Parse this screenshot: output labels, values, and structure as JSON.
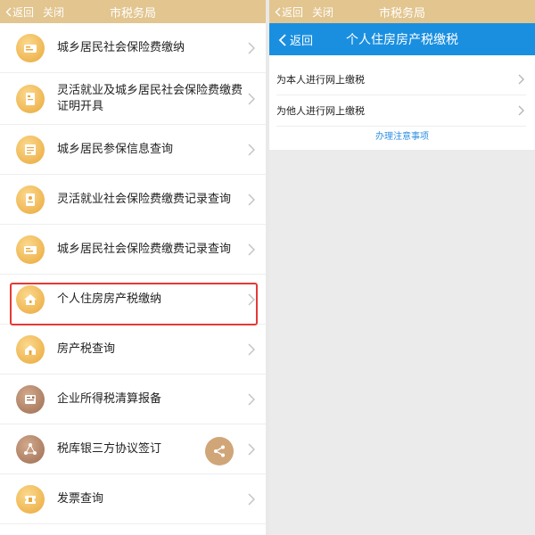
{
  "left_panel": {
    "topbar": {
      "back_label": "返回",
      "close_label": "关闭",
      "title": "市税务局"
    },
    "items": [
      {
        "label": "城乡居民社会保险费缴纳",
        "icon": "social-insurance-icon"
      },
      {
        "label": "灵活就业及城乡居民社会保险费缴费证明开具",
        "icon": "certificate-icon"
      },
      {
        "label": "城乡居民参保信息查询",
        "icon": "info-query-icon"
      },
      {
        "label": "灵活就业社会保险费缴费记录查询",
        "icon": "record-query-icon"
      },
      {
        "label": "城乡居民社会保险费缴费记录查询",
        "icon": "social-insurance-icon"
      },
      {
        "label": "个人住房房产税缴纳",
        "icon": "house-icon"
      },
      {
        "label": "房产税查询",
        "icon": "house-query-icon"
      },
      {
        "label": "企业所得税清算报备",
        "icon": "report-icon"
      },
      {
        "label": "税库银三方协议签订",
        "icon": "agreement-icon"
      },
      {
        "label": "发票查询",
        "icon": "invoice-icon"
      }
    ],
    "highlighted_item": "个人住房房产税缴纳",
    "share_icon": "share-icon"
  },
  "right_panel": {
    "topbar": {
      "back_label": "返回",
      "close_label": "关闭",
      "title": "市税务局"
    },
    "header": {
      "back_label": "返回",
      "title": "个人住房房产税缴税"
    },
    "options": [
      {
        "label": "为本人进行网上缴税"
      },
      {
        "label": "为他人进行网上缴税"
      }
    ],
    "note_link": "办理注意事项"
  },
  "colors": {
    "wechat_bar": "#e2c58f",
    "blue_header": "#1a8fe0",
    "icon_gold": "#eaa73a",
    "icon_brown": "#9c6d52",
    "highlight_red": "#e53935",
    "link_blue": "#2f8fe2"
  }
}
